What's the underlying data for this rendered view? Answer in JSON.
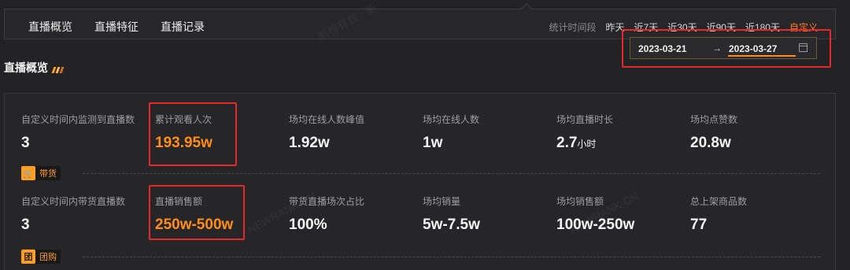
{
  "nav": {
    "tabs": [
      "直播概览",
      "直播特征",
      "直播记录"
    ],
    "period_label": "统计时间段",
    "periods": [
      "昨天",
      "近7天",
      "近30天",
      "近90天",
      "近180天",
      "自定义"
    ],
    "active_period": "自定义"
  },
  "date_range": {
    "start": "2023-03-21",
    "arrow": "→",
    "end": "2023-03-27",
    "icon": "calendar-icon"
  },
  "section": {
    "title": "直播概览"
  },
  "rows": [
    {
      "metrics": [
        {
          "label": "自定义时间内监测到直播数",
          "value": "3"
        },
        {
          "label": "累计观看人次",
          "value": "193.95w"
        },
        {
          "label": "场均在线人数峰值",
          "value": "1.92w"
        },
        {
          "label": "场均在线人数",
          "value": "1w"
        },
        {
          "label": "场均直播时长",
          "value": "2.7",
          "unit": "小时"
        },
        {
          "label": "场均点赞数",
          "value": "20.8w"
        }
      ],
      "tag": {
        "icon_char": "🛒",
        "text": "带货"
      }
    },
    {
      "metrics": [
        {
          "label": "自定义时间内带货直播数",
          "value": "3"
        },
        {
          "label": "直播销售额",
          "value": "250w-500w"
        },
        {
          "label": "带货直播场次占比",
          "value": "100%"
        },
        {
          "label": "场均销量",
          "value": "5w-7.5w"
        },
        {
          "label": "场均销售额",
          "value": "100w-250w"
        },
        {
          "label": "总上架商品数",
          "value": "77"
        }
      ],
      "tag": {
        "icon_char": "团",
        "text": "团购"
      }
    }
  ],
  "colors": {
    "accent": "#ff8c1a",
    "highlight_box": "#e4282b",
    "background": "#232325"
  }
}
